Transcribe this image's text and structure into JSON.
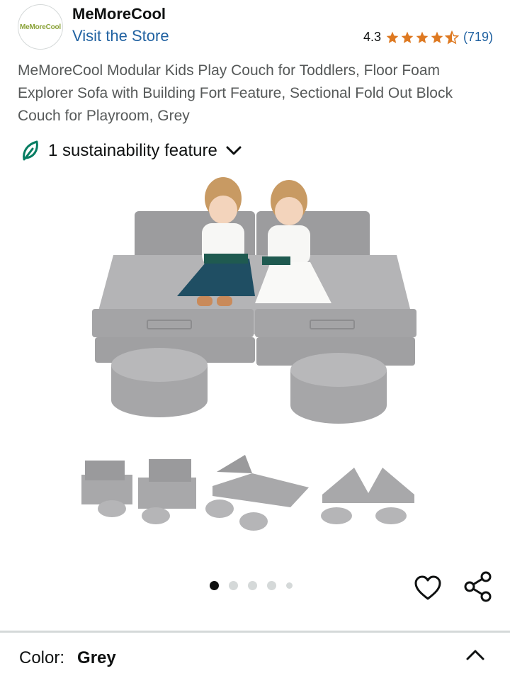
{
  "brand": {
    "logo_text": "MeMoreCool",
    "name": "MeMoreCool",
    "visit_link": "Visit the Store"
  },
  "rating": {
    "value": "4.3",
    "stars": 4.3,
    "reviews": "(719)",
    "star_color": "#de7921"
  },
  "product": {
    "title": "MeMoreCool Modular Kids Play Couch for Toddlers, Floor Foam Explorer Sofa with Building Fort Feature, Sectional Fold Out Block Couch for Playroom, Grey"
  },
  "sustainability": {
    "label": "1 sustainability feature",
    "icon": "leaf-icon",
    "color": "#067d62"
  },
  "gallery": {
    "image_count": 5,
    "active_index": 0
  },
  "actions": {
    "wishlist_icon": "heart-icon",
    "share_icon": "share-icon"
  },
  "variation": {
    "label": "Color:",
    "value": "Grey"
  },
  "colors": {
    "link": "#2162a1",
    "text": "#0f1111",
    "muted": "#565959",
    "sofa": "#a9a9ab"
  }
}
